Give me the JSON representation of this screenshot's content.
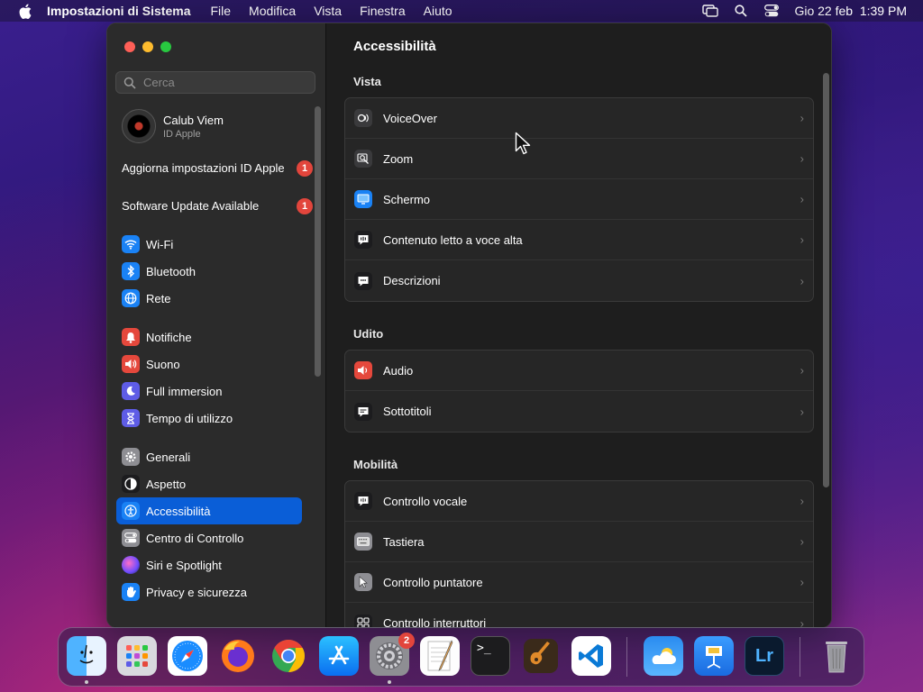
{
  "menubar": {
    "app_name": "Impostazioni di Sistema",
    "menus": [
      "File",
      "Modifica",
      "Vista",
      "Finestra",
      "Aiuto"
    ],
    "datetime": "Gio 22 feb  1:39 PM"
  },
  "sidebar": {
    "search_placeholder": "Cerca",
    "account": {
      "name": "Calub Viem",
      "subtitle": "ID Apple"
    },
    "notices": [
      {
        "label": "Aggiorna impostazioni ID Apple",
        "badge": "1"
      },
      {
        "label": "Software Update Available",
        "badge": "1"
      }
    ],
    "items": [
      {
        "label": "Wi-Fi",
        "icon": "wifi-icon",
        "color": "#1a82f5"
      },
      {
        "label": "Bluetooth",
        "icon": "bluetooth-icon",
        "color": "#1a82f5"
      },
      {
        "label": "Rete",
        "icon": "globe-icon",
        "color": "#1a82f5"
      },
      {
        "label": "Notifiche",
        "icon": "bell-icon",
        "color": "#e5483c"
      },
      {
        "label": "Suono",
        "icon": "speaker-icon",
        "color": "#e5483c"
      },
      {
        "label": "Full immersion",
        "icon": "moon-icon",
        "color": "#5e5ce6"
      },
      {
        "label": "Tempo di utilizzo",
        "icon": "hourglass-icon",
        "color": "#5e5ce6"
      },
      {
        "label": "Generali",
        "icon": "gear-icon",
        "color": "#8e8e93"
      },
      {
        "label": "Aspetto",
        "icon": "appearance-icon",
        "color": "#1c1c1e"
      },
      {
        "label": "Accessibilità",
        "icon": "accessibility-icon",
        "color": "#1a82f5",
        "selected": true
      },
      {
        "label": "Centro di Controllo",
        "icon": "control-center-icon",
        "color": "#8e8e93"
      },
      {
        "label": "Siri e Spotlight",
        "icon": "siri-icon",
        "color": "#c04bd6"
      },
      {
        "label": "Privacy e sicurezza",
        "icon": "hand-icon",
        "color": "#1a82f5"
      }
    ]
  },
  "main": {
    "title": "Accessibilità",
    "sections": [
      {
        "title": "Vista",
        "rows": [
          {
            "label": "VoiceOver",
            "icon": "voiceover-icon"
          },
          {
            "label": "Zoom",
            "icon": "zoom-icon"
          },
          {
            "label": "Schermo",
            "icon": "display-icon"
          },
          {
            "label": "Contenuto letto a voce alta",
            "icon": "spoken-content-icon"
          },
          {
            "label": "Descrizioni",
            "icon": "descriptions-icon"
          }
        ]
      },
      {
        "title": "Udito",
        "rows": [
          {
            "label": "Audio",
            "icon": "audio-icon"
          },
          {
            "label": "Sottotitoli",
            "icon": "captions-icon"
          }
        ]
      },
      {
        "title": "Mobilità",
        "rows": [
          {
            "label": "Controllo vocale",
            "icon": "voice-control-icon"
          },
          {
            "label": "Tastiera",
            "icon": "keyboard-icon"
          },
          {
            "label": "Controllo puntatore",
            "icon": "pointer-icon"
          },
          {
            "label": "Controllo interruttori",
            "icon": "switch-control-icon"
          }
        ]
      }
    ]
  },
  "dock": {
    "apps": [
      "finder-icon",
      "launchpad-icon",
      "safari-icon",
      "firefox-icon",
      "chrome-icon",
      "app-store-icon",
      "system-settings-icon",
      "textedit-icon",
      "terminal-icon",
      "garageband-icon",
      "vscode-icon",
      "weather-icon",
      "keynote-icon",
      "lightroom-icon",
      "trash-icon"
    ],
    "settings_badge": "2",
    "terminal_glyph": ">_",
    "lightroom_glyph": "Lr"
  }
}
